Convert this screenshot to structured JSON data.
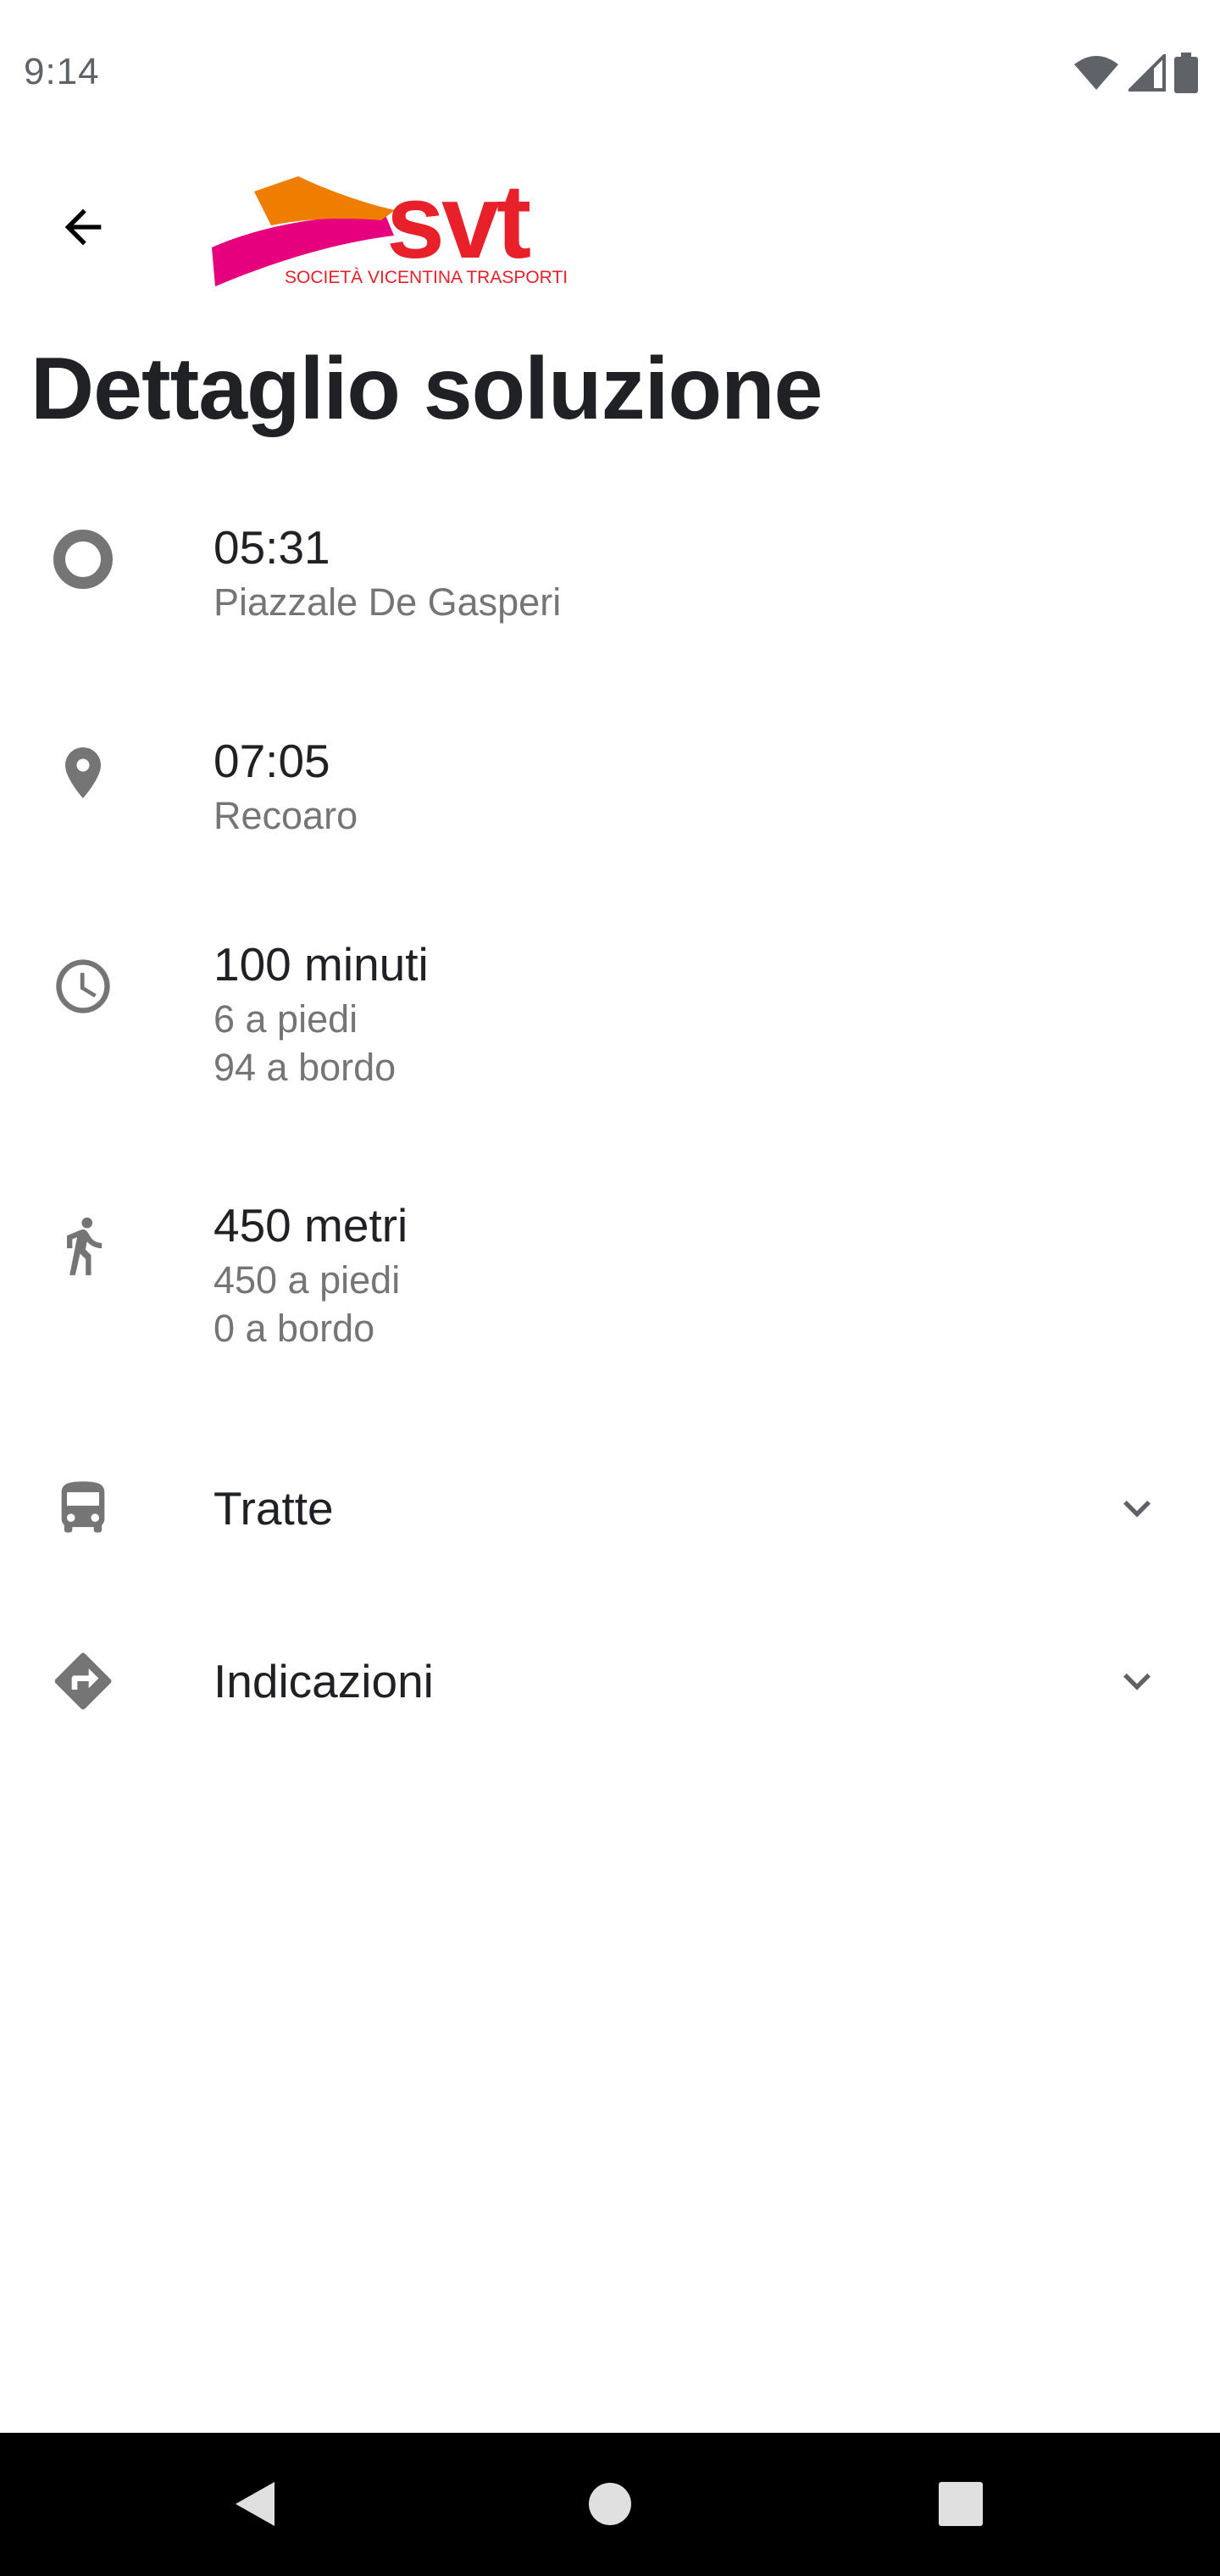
{
  "status_bar": {
    "time": "9:14",
    "icons": [
      "wifi-icon",
      "cell-signal-icon",
      "battery-icon"
    ]
  },
  "app_bar": {
    "back_icon": "arrow-back-icon",
    "logo": {
      "brand": "svt",
      "tagline": "SOCIETÀ VICENTINA TRASPORTI",
      "colors": {
        "red": "#e8202a",
        "orange": "#ef7d00",
        "magenta": "#e6007e"
      }
    }
  },
  "title": "Dettaglio soluzione",
  "rows": {
    "departure": {
      "icon": "origin-circle-icon",
      "time": "05:31",
      "place": "Piazzale De Gasperi"
    },
    "arrival": {
      "icon": "location-pin-icon",
      "time": "07:05",
      "place": "Recoaro"
    },
    "duration": {
      "icon": "clock-icon",
      "total": "100 minuti",
      "walking": "6 a piedi",
      "onboard": "94 a bordo"
    },
    "distance": {
      "icon": "walking-icon",
      "total": "450 metri",
      "walking": "450 a piedi",
      "onboard": "0 a bordo"
    },
    "legs": {
      "icon": "bus-icon",
      "label": "Tratte",
      "chevron": "chevron-down-icon"
    },
    "directions": {
      "icon": "directions-icon",
      "label": "Indicazioni",
      "chevron": "chevron-down-icon"
    }
  },
  "colors": {
    "icon_gray": "#757575",
    "text_primary": "#202124",
    "text_secondary": "#757575"
  },
  "nav_bar": {
    "icons": [
      "nav-back-icon",
      "nav-home-icon",
      "nav-recents-icon"
    ]
  }
}
